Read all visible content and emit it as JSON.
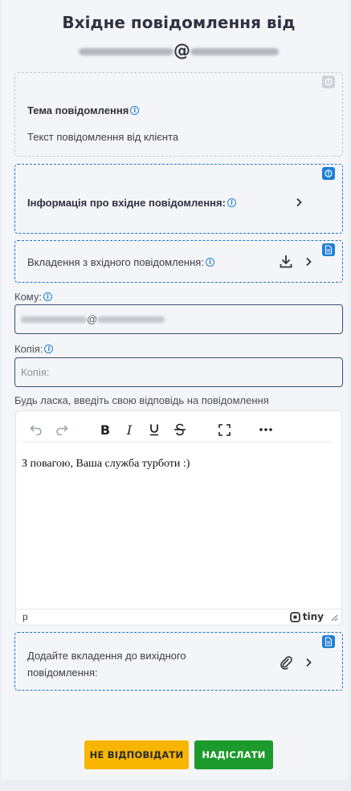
{
  "header": {
    "title_line1": "Вхідне повідомлення від",
    "at_sign": "@"
  },
  "message_card": {
    "subject_label": "Тема повідомлення",
    "body_text": "Текст повідомлення від клієнта"
  },
  "info_card": {
    "label": "Інформація про вхідне повідомлення:"
  },
  "attachments_in_card": {
    "label": "Вкладення з вхідного повідомлення:"
  },
  "to_field": {
    "label": "Кому:",
    "at_sign": "@"
  },
  "cc_field": {
    "label": "Копія:",
    "placeholder": "Копія:"
  },
  "reply_prompt": "Будь ласка, введіть свою відповідь на повідомлення",
  "editor": {
    "content": "З повагою, Ваша служба турботи :)",
    "status_path": "p",
    "brand": "tiny"
  },
  "attachments_out_card": {
    "label_line1": "Додайте вкладення до вихідного",
    "label_line2": "повідомлення:"
  },
  "buttons": {
    "no_reply": "НЕ ВІДПОВІДАТИ",
    "send": "НАДІСЛАТИ"
  },
  "colors": {
    "accent_blue": "#1f7fd6",
    "no_reply_bg": "#f7b500",
    "send_bg": "#1c9a2b"
  },
  "icons": [
    "info-icon",
    "chevron-right-icon",
    "download-icon",
    "file-icon",
    "undo-icon",
    "redo-icon",
    "bold-icon",
    "italic-icon",
    "underline-icon",
    "strikethrough-icon",
    "fullscreen-icon",
    "more-icon",
    "paperclip-icon",
    "resize-handle-icon"
  ]
}
